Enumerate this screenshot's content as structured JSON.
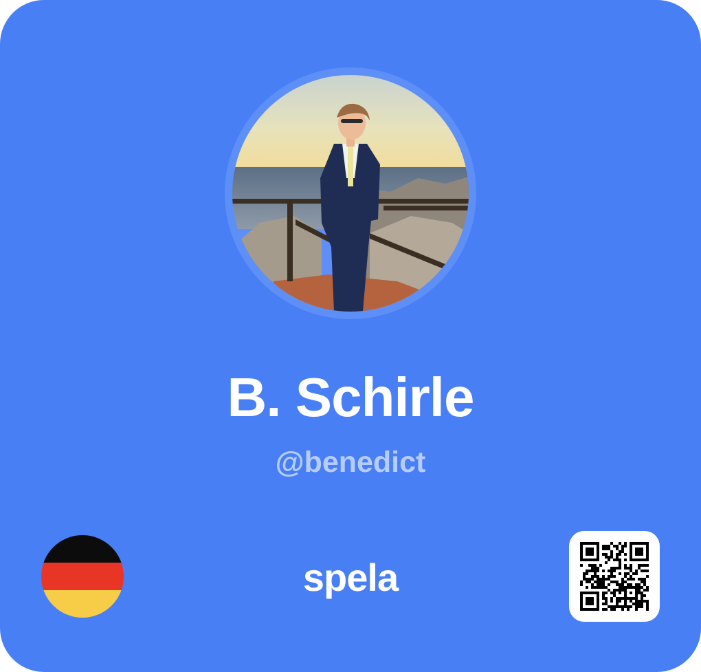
{
  "profile": {
    "display_name": "B. Schirle",
    "username": "@benedict",
    "photo_icon": "profile-photo",
    "country_flag": "germany-flag-icon"
  },
  "footer": {
    "brand": "spela",
    "qr_icon": "qr-code-icon"
  },
  "colors": {
    "card_background": "#487ff5",
    "avatar_ring": "#5d8ff7",
    "name_text": "#ffffff",
    "username_text": "#b6cdfb",
    "brand_text": "#ffffff",
    "flag_black": "#0c0c0c",
    "flag_red": "#e93525",
    "flag_gold": "#f7cd48"
  }
}
